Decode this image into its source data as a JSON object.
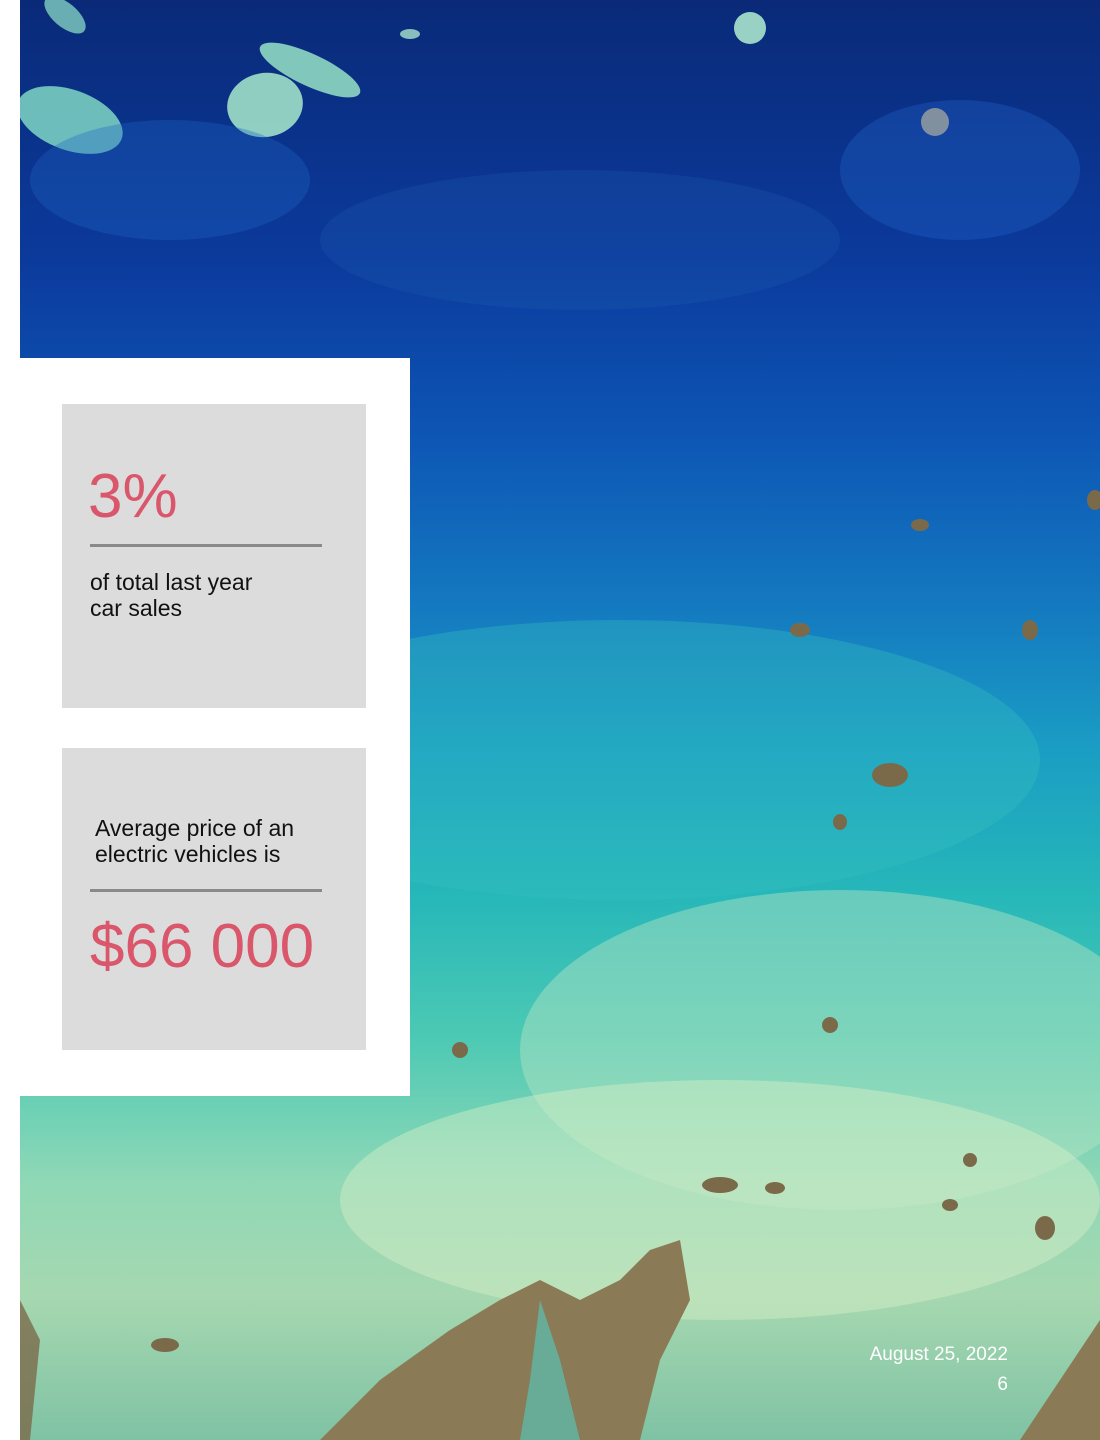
{
  "stat_1": {
    "value": "3%",
    "description": "of total last year\ncar sales"
  },
  "stat_2": {
    "description": "Average  price of an\nelectric vehicles is",
    "value": "$66 000"
  },
  "footer": {
    "date": "August 25, 2022",
    "page_number": "6"
  },
  "colors": {
    "accent": "#d9566b",
    "card_background": "#dcdcdc",
    "divider": "#8a8a8a"
  }
}
